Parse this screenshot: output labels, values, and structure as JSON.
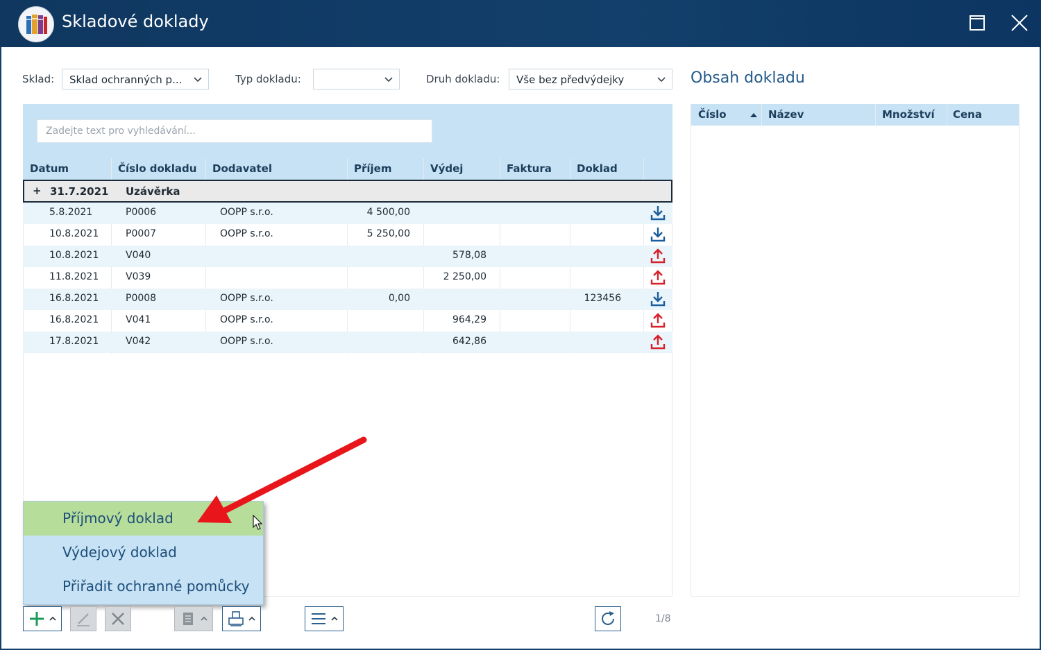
{
  "window": {
    "title": "Skladové doklady"
  },
  "filters": {
    "sklad_label": "Sklad:",
    "sklad_value": "Sklad ochranných p...",
    "typ_label": "Typ dokladu:",
    "typ_value": "",
    "druh_label": "Druh dokladu:",
    "druh_value": "Vše bez předvýdejky"
  },
  "search": {
    "placeholder": "Zadejte text pro vyhledávání..."
  },
  "table": {
    "columns": [
      "Datum",
      "Číslo dokladu",
      "Dodavatel",
      "Příjem",
      "Výdej",
      "Faktura",
      "Doklad"
    ],
    "group": {
      "toggle": "+",
      "date": "31.7.2021",
      "label": "Uzávěrka"
    },
    "rows": [
      {
        "datum": "5.8.2021",
        "cislo": "P0006",
        "dodavatel": "OOPP s.r.o.",
        "prijem": "4 500,00",
        "vydej": "",
        "faktura": "",
        "doklad": "",
        "icon": "download-icon"
      },
      {
        "datum": "10.8.2021",
        "cislo": "P0007",
        "dodavatel": "OOPP s.r.o.",
        "prijem": "5 250,00",
        "vydej": "",
        "faktura": "",
        "doklad": "",
        "icon": "download-icon"
      },
      {
        "datum": "10.8.2021",
        "cislo": "V040",
        "dodavatel": "",
        "prijem": "",
        "vydej": "578,08",
        "faktura": "",
        "doklad": "",
        "icon": "upload-icon"
      },
      {
        "datum": "11.8.2021",
        "cislo": "V039",
        "dodavatel": "",
        "prijem": "",
        "vydej": "2 250,00",
        "faktura": "",
        "doklad": "",
        "icon": "upload-icon"
      },
      {
        "datum": "16.8.2021",
        "cislo": "P0008",
        "dodavatel": "OOPP s.r.o.",
        "prijem": "0,00",
        "vydej": "",
        "faktura": "",
        "doklad": "123456",
        "icon": "download-icon"
      },
      {
        "datum": "16.8.2021",
        "cislo": "V041",
        "dodavatel": "OOPP s.r.o.",
        "prijem": "",
        "vydej": "964,29",
        "faktura": "",
        "doklad": "",
        "icon": "upload-icon"
      },
      {
        "datum": "17.8.2021",
        "cislo": "V042",
        "dodavatel": "OOPP s.r.o.",
        "prijem": "",
        "vydej": "642,86",
        "faktura": "",
        "doklad": "",
        "icon": "upload-icon"
      }
    ]
  },
  "popup_menu": {
    "items": [
      "Příjmový doklad",
      "Výdejový doklad",
      "Přiřadit ochranné pomůcky"
    ],
    "highlighted_index": 0
  },
  "pager": {
    "text": "1/8"
  },
  "obsah": {
    "title": "Obsah dokladu",
    "columns": [
      "Číslo",
      "Název",
      "Množství",
      "Cena"
    ]
  },
  "colors": {
    "titlebar": "#123f6b",
    "header_band": "#c6e2f4",
    "download_icon": "#1b5e9b",
    "upload_icon": "#d7202a",
    "highlight": "#b6dd9a",
    "annotation_arrow": "#e8161b"
  }
}
